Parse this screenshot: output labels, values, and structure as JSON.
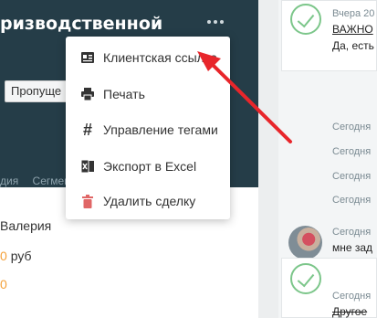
{
  "deal": {
    "title": "ризводственной",
    "status_value": "Пропуще",
    "tabs": [
      "дия",
      "Сегмент"
    ],
    "contact_name": "Валерия",
    "amount_number": "0",
    "amount_unit": "руб",
    "extra_value": "0"
  },
  "menu": {
    "items": [
      {
        "label": "Клиентская ссылка",
        "icon": "id-card-icon"
      },
      {
        "label": "Печать",
        "icon": "printer-icon"
      },
      {
        "label": "Управление тегами",
        "icon": "hash-icon"
      },
      {
        "label": "Экспорт в Excel",
        "icon": "excel-icon"
      },
      {
        "label": "Удалить сделку",
        "icon": "trash-icon"
      }
    ]
  },
  "feed": {
    "card1": {
      "date": "Вчера 20",
      "title": "ВАЖНО",
      "text": "Да, есть"
    },
    "system_dates": [
      "Сегодня",
      "Сегодня",
      "Сегодня",
      "Сегодня"
    ],
    "message": {
      "date": "Сегодня",
      "text": "мне зад"
    },
    "card2": {
      "date": "Сегодня",
      "title": "Другое"
    }
  },
  "colors": {
    "header_bg": "#253d48",
    "accent_orange": "#f4a13a",
    "check_green": "#7cc68a",
    "delete_red": "#e06666",
    "arrow_red": "#e8262b"
  }
}
